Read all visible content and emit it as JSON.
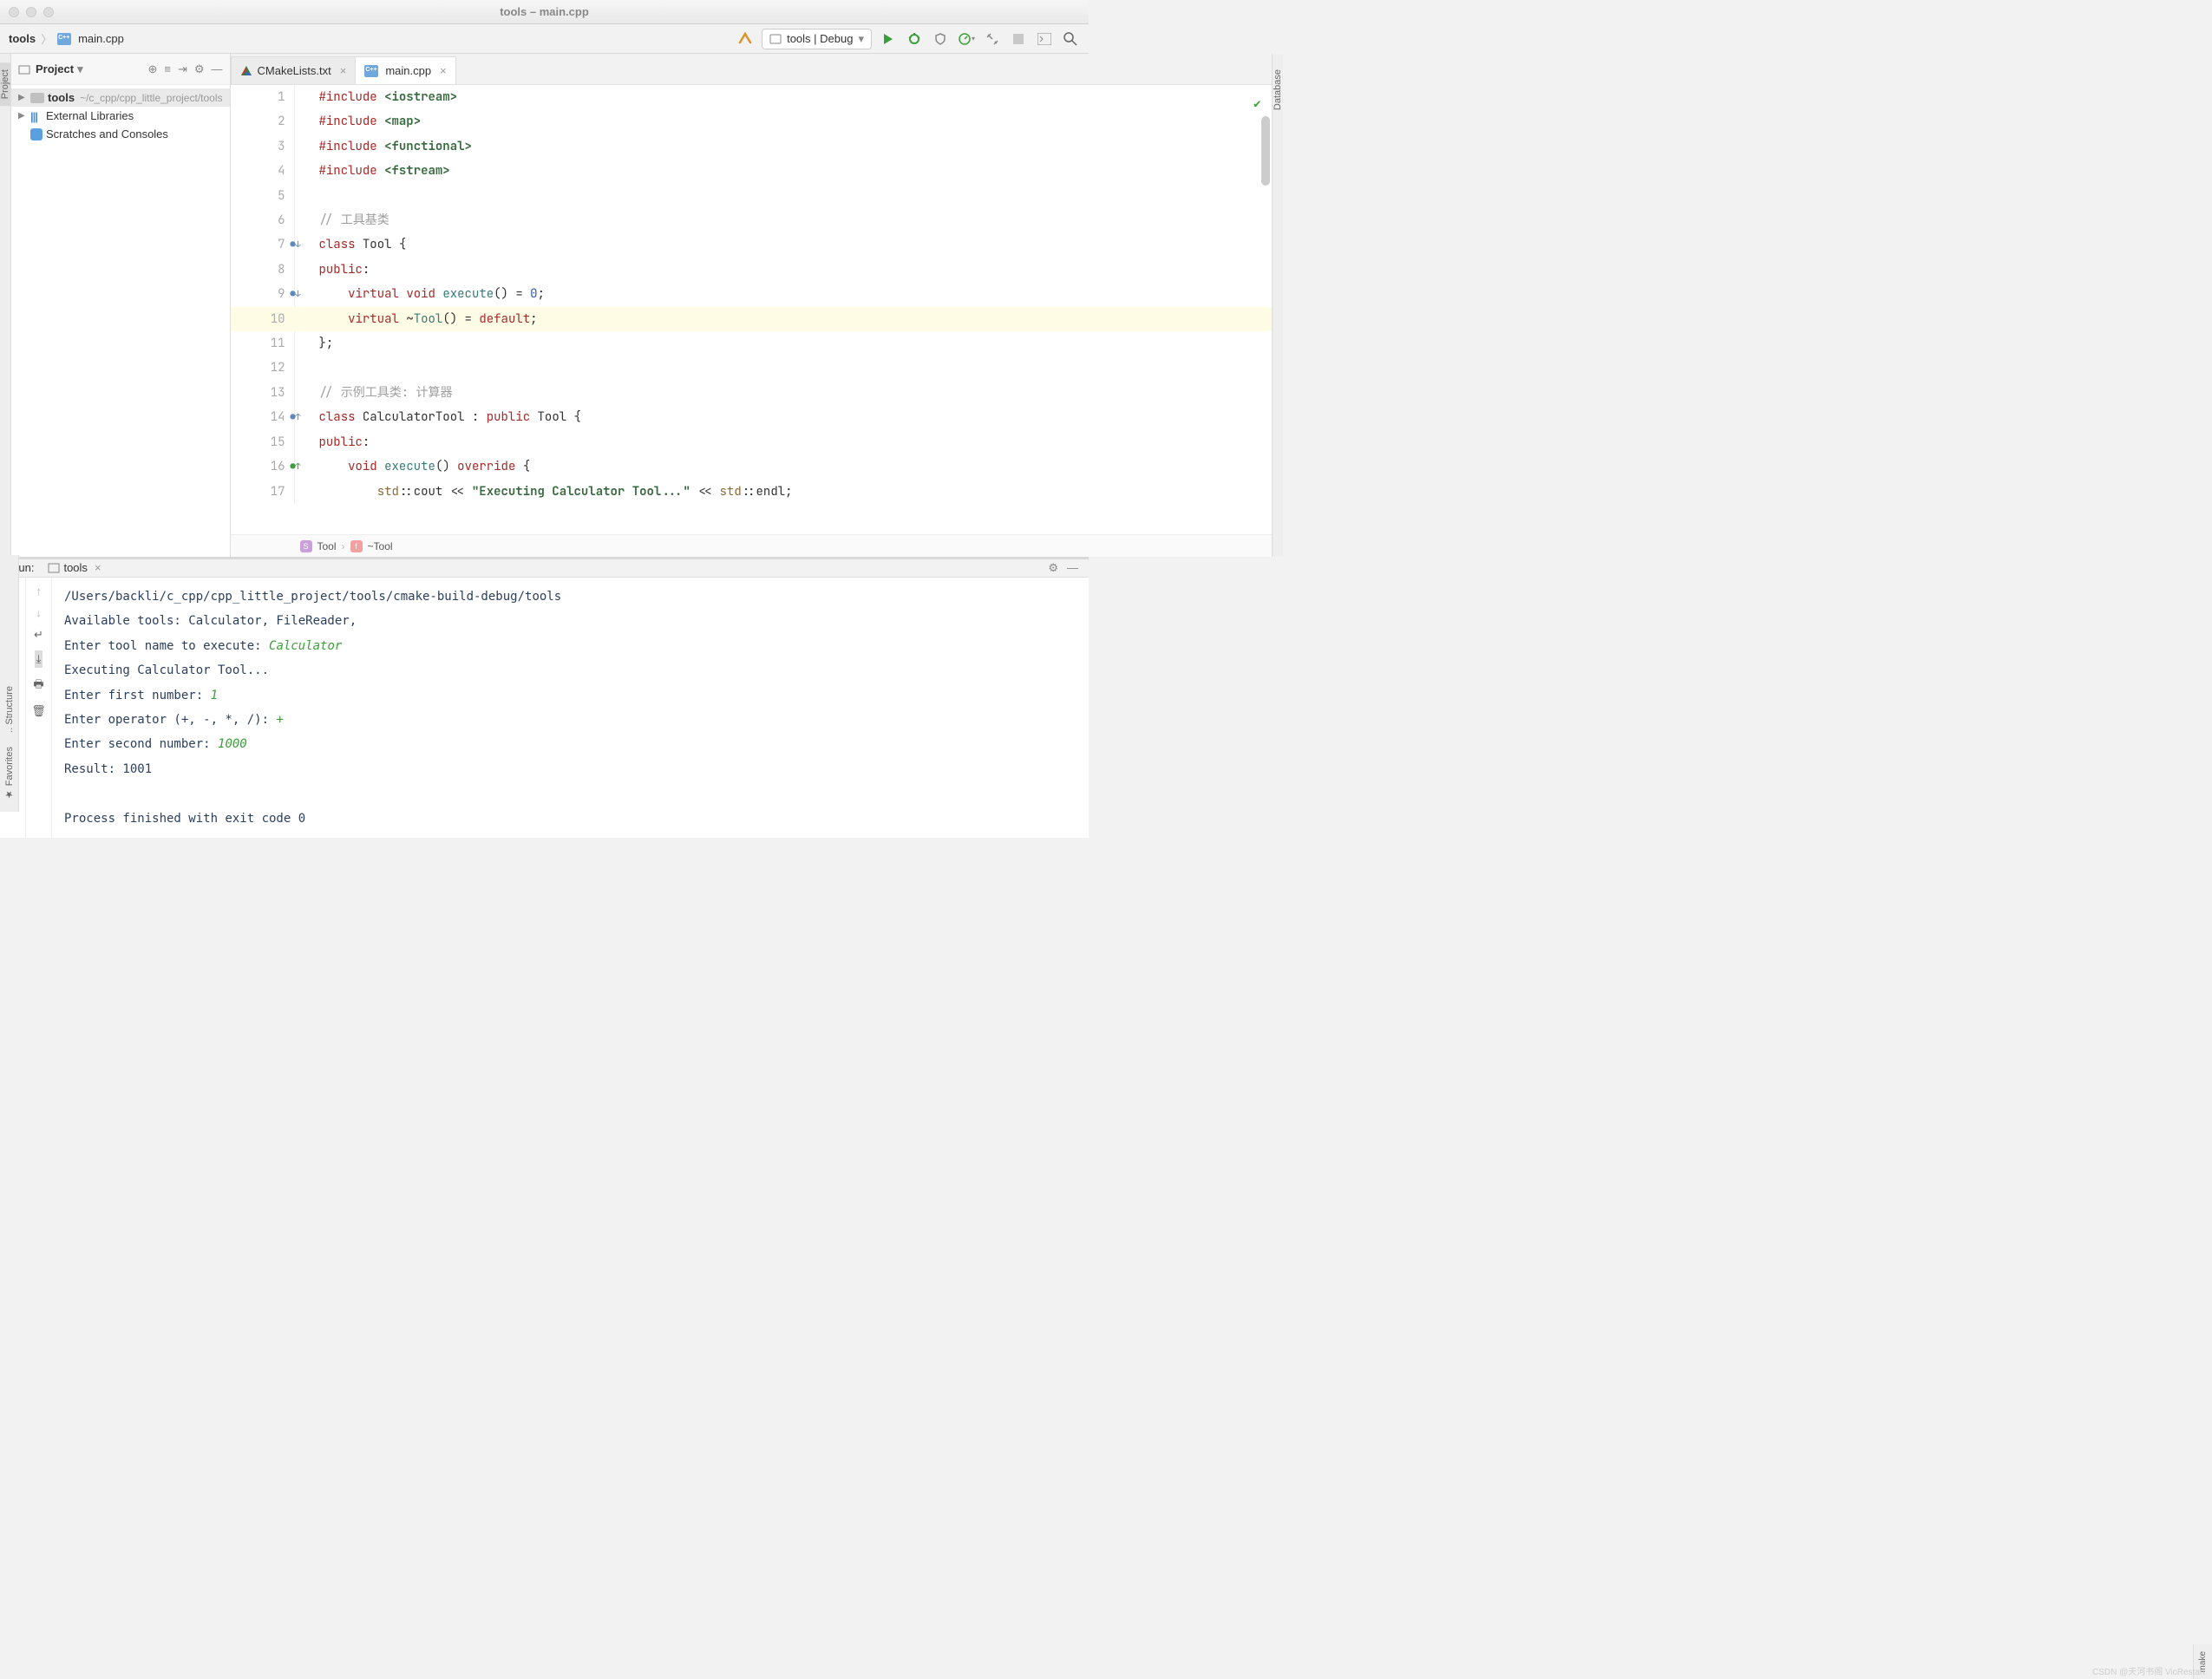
{
  "window": {
    "title": "tools – main.cpp"
  },
  "breadcrumb": {
    "root": "tools",
    "file": "main.cpp"
  },
  "run_config": {
    "label": "tools | Debug"
  },
  "left_rail": {
    "project": "Project"
  },
  "right_rail": {
    "database": "Database",
    "make": "make"
  },
  "bottom_rail": {
    "structure": "Structure",
    "favorites": "Favorites"
  },
  "project_panel": {
    "title": "Project",
    "root": {
      "name": "tools",
      "path": "~/c_cpp/cpp_little_project/tools"
    },
    "ext_lib": "External Libraries",
    "scratch": "Scratches and Consoles"
  },
  "tabs": [
    {
      "label": "CMakeLists.txt",
      "active": false
    },
    {
      "label": "main.cpp",
      "active": true
    }
  ],
  "code": {
    "lines": [
      {
        "n": 1,
        "html": "<span class='kw'>#include</span> <span class='str'>&lt;iostream&gt;</span>"
      },
      {
        "n": 2,
        "html": "<span class='kw'>#include</span> <span class='str'>&lt;map&gt;</span>"
      },
      {
        "n": 3,
        "html": "<span class='kw'>#include</span> <span class='str'>&lt;functional&gt;</span>"
      },
      {
        "n": 4,
        "html": "<span class='kw'>#include</span> <span class='str'>&lt;fstream&gt;</span>"
      },
      {
        "n": 5,
        "html": ""
      },
      {
        "n": 6,
        "html": "<span class='cm'>// 工具基类</span>"
      },
      {
        "n": 7,
        "html": "<span class='kw'>class</span> <span class='op'>Tool {</span>",
        "mark": "o↓"
      },
      {
        "n": 8,
        "html": "<span class='pub'>public</span>:"
      },
      {
        "n": 9,
        "html": "    <span class='kw'>virtual</span> <span class='kw'>void</span> <span class='fn'>execute</span>() = <span class='num'>0</span>;",
        "mark": "o↓"
      },
      {
        "n": 10,
        "html": "    <span class='kw'>virtual</span> ~<span class='fn'>Tool</span>() = <span class='kw'>default</span>;",
        "hl": true
      },
      {
        "n": 11,
        "html": "};"
      },
      {
        "n": 12,
        "html": ""
      },
      {
        "n": 13,
        "html": "<span class='cm'>// 示例工具类: 计算器</span>"
      },
      {
        "n": 14,
        "html": "<span class='kw'>class</span> <span class='op'>CalculatorTool</span> : <span class='kw'>public</span> <span class='op'>Tool</span> {",
        "mark": "o↑"
      },
      {
        "n": 15,
        "html": "<span class='pub'>public</span>:"
      },
      {
        "n": 16,
        "html": "    <span class='kw'>void</span> <span class='fn'>execute</span>() <span class='kw'>override</span> {",
        "mark": "g↑"
      },
      {
        "n": 17,
        "html": "        <span class='type'>std</span>::cout &lt;&lt; <span class='str'>\"Executing Calculator Tool...\"</span> &lt;&lt; <span class='type'>std</span>::endl;"
      }
    ]
  },
  "editor_breadcrumb": {
    "struct": "Tool",
    "func": "~Tool"
  },
  "run_panel": {
    "label": "Run:",
    "tab": "tools",
    "lines": [
      {
        "t": "/Users/backli/c_cpp/cpp_little_project/tools/cmake-build-debug/tools"
      },
      {
        "t": "Available tools: Calculator, FileReader,"
      },
      {
        "t": "Enter tool name to execute: ",
        "inp": "Calculator"
      },
      {
        "t": "Executing Calculator Tool..."
      },
      {
        "t": "Enter first number: ",
        "inp": "1"
      },
      {
        "t": "Enter operator (+, -, *, /): ",
        "inp": "+"
      },
      {
        "t": "Enter second number: ",
        "inp": "1000"
      },
      {
        "t": "Result: 1001"
      },
      {
        "t": ""
      },
      {
        "t": "Process finished with exit code 0"
      }
    ]
  },
  "watermark": "CSDN @天河书阁 VicRestart"
}
